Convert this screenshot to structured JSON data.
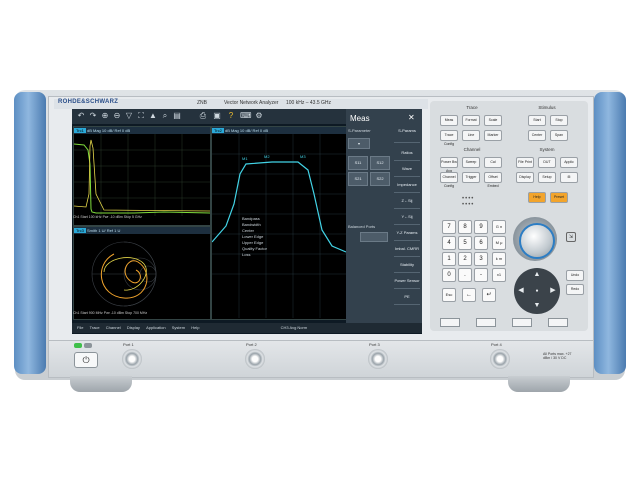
{
  "header": {
    "brand": "ROHDE&SCHWARZ",
    "model": "ZNB",
    "model_desc": "Vector Network Analyzer",
    "freq_range": "100 kHz – 43.5 GHz"
  },
  "screen": {
    "diagrams": [
      {
        "tag": "Trc1",
        "title": "dB Mag  10 dB/ Ref 0 dB"
      },
      {
        "tag": "Trc2",
        "title": "dB Mag  10 dB/ Ref 0 dB"
      },
      {
        "tag": "Trc3",
        "title": "Smith  1 U/ Ref 1 U"
      }
    ],
    "stimulus_rows": [
      "Ch1  Start  100 kHz  Pwr  -10 dBm  Stop  5 GHz",
      "Ch1  Start  900 MHz  Pwr  -10 dBm  Stop  700 MHz"
    ],
    "marker_table": [
      "Bandpass",
      "Bandwidth",
      "Center",
      "Lower Edge",
      "Upper Edge",
      "Quality Factor",
      "Loss"
    ],
    "menu_bar": [
      "File",
      "Trace",
      "Channel",
      "Display",
      "Application",
      "System",
      "Help"
    ],
    "status_text": "CH3  Avg Norm",
    "meas_panel": {
      "title": "Meas",
      "close": "✕",
      "s_param_label": "S-Parameter",
      "s_params": [
        "S11",
        "S12",
        "S21",
        "S22"
      ],
      "group_label": "Balanced Ports",
      "side_items": [
        "S-Params",
        "Ratios",
        "Wave",
        "Impedance",
        "Z←Sij",
        "Y←Sij",
        "Y-Z Params",
        "Imbal. CMRR",
        "Stability",
        "Power Sensor",
        "PE"
      ]
    }
  },
  "keypad": {
    "sections": [
      "Trace",
      "Channel",
      "Stimulus",
      "System"
    ],
    "trace_keys": [
      "Meas",
      "Format",
      "Scale",
      "Trace Config",
      "Line",
      "Marker"
    ],
    "channel_keys": [
      "Power Bw Avg",
      "Sweep",
      "Cal",
      "Channel Config",
      "Trigger",
      "Offset Embed"
    ],
    "stimulus_keys": [
      "Start",
      "Stop",
      "Center",
      "Span"
    ],
    "system_keys": [
      "File Print",
      "DUT",
      "Applic",
      "Display",
      "Setup"
    ],
    "help_keys": [
      "Help",
      "Preset"
    ],
    "numbers": [
      "7",
      "8",
      "9",
      "4",
      "5",
      "6",
      "1",
      "2",
      "3",
      "0",
      ".",
      "-"
    ],
    "unit_keys": [
      "G n",
      "M μ",
      "k m",
      "x1"
    ],
    "function_keys": [
      "Esc",
      "←",
      "↵"
    ],
    "side_keys": [
      "Undo",
      "Redo"
    ]
  },
  "front": {
    "ports": [
      "Port 1",
      "Port 2",
      "Port 3",
      "Port 4"
    ],
    "power_icon": "power-icon",
    "warning": "All Ports max. +27 dBm / 30 V DC"
  },
  "colors": {
    "handle": "#6a9bcf",
    "trace_yellow": "#e6d84a",
    "trace_green": "#7fdc3c",
    "trace_cyan": "#42d3e6",
    "accent_orange": "#f2a42c",
    "accent_blue": "#2c7dc4"
  }
}
